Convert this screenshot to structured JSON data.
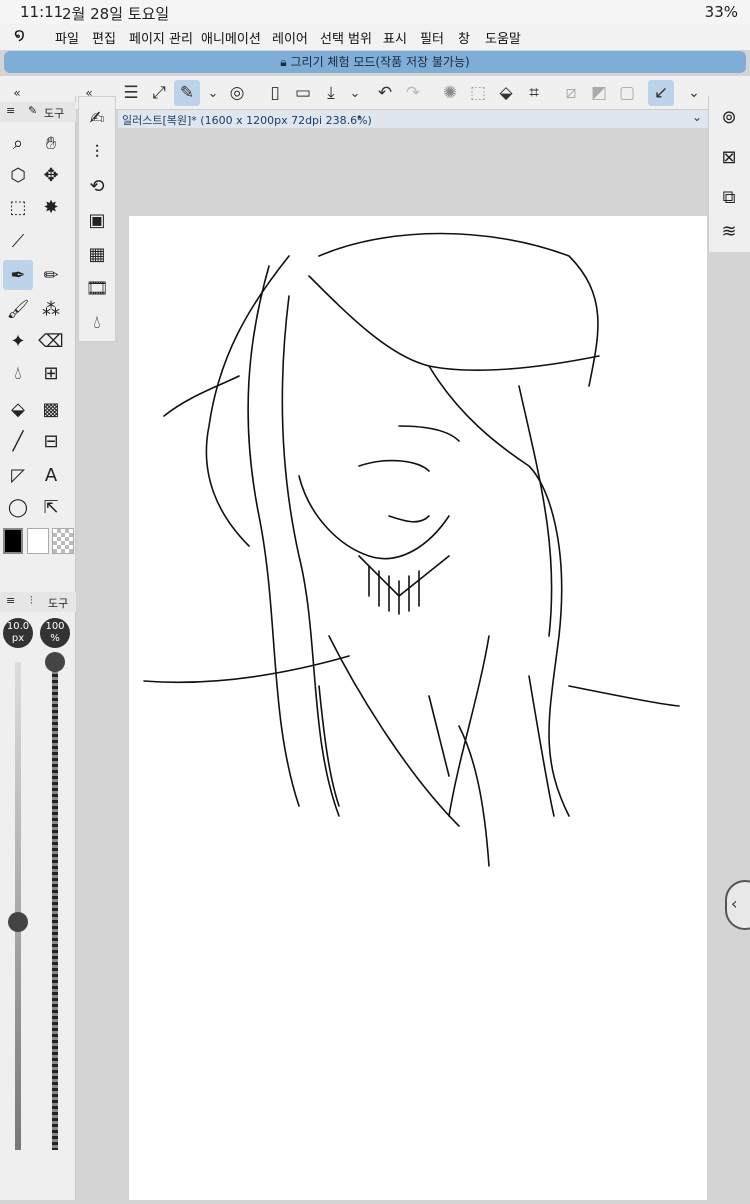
{
  "status": {
    "time": "11:11",
    "date": "2월 28일 토요일",
    "battery": "33%"
  },
  "menu": {
    "items": [
      "파일",
      "편집",
      "페이지 관리",
      "애니메이션",
      "레이어",
      "선택 범위",
      "표시",
      "필터",
      "창",
      "도움말"
    ]
  },
  "banner": {
    "text": "그리기 체험 모드(작품 저장 불가능)"
  },
  "document": {
    "tab_title": "일러스트[복원]* (1600 x 1200px 72dpi 238.6%)"
  },
  "tool_panel": {
    "title": "도구",
    "brush_size": "10.0\npx",
    "opacity": "100\n%"
  },
  "property_panel": {
    "title": "도구"
  },
  "colors": {
    "main": "#000000",
    "sub": "#ffffff",
    "accent": "#bcd3ea",
    "banner": "#7eaed8"
  }
}
